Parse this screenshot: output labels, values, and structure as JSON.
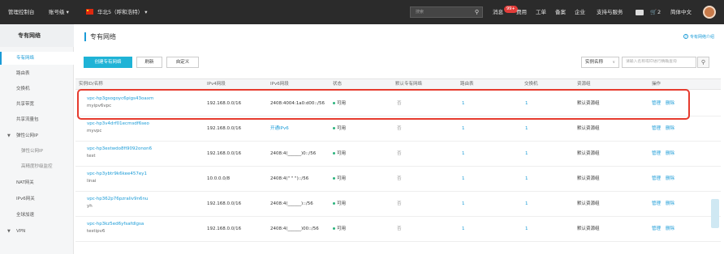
{
  "topbar": {
    "console": "管理控制台",
    "account": "账号级 ▾",
    "region": "华北5（呼和浩特） ▾",
    "search_placeholder": "搜索",
    "search_icon": "search-icon",
    "messages": "消息",
    "badge": "99+",
    "billing": "费用",
    "ticket": "工单",
    "icp": "备案",
    "enterprise": "企业",
    "support": "支持与服务",
    "cart_count": "2",
    "language": "简体中文"
  },
  "sidebar": {
    "title": "专有网络",
    "items": [
      {
        "label": "专有网络",
        "active": true
      },
      {
        "label": "路由表"
      },
      {
        "label": "交换机"
      },
      {
        "label": "共享带宽"
      },
      {
        "label": "共享流量包"
      },
      {
        "label": "弹性公网IP",
        "group": true
      },
      {
        "label": "弹性公网IP",
        "sub": true
      },
      {
        "label": "高精度秒级监控",
        "sub": true
      },
      {
        "label": "NAT网关"
      },
      {
        "label": "IPv6网关"
      },
      {
        "label": "全球加速"
      },
      {
        "label": "VPN",
        "group": true
      }
    ]
  },
  "main": {
    "title": "专有网络",
    "help": "专有网络介绍",
    "buttons": {
      "create": "创建专有网络",
      "refresh": "刷新",
      "custom": "自定义"
    },
    "filter": {
      "select": "实例名称",
      "placeholder": "请输入名称或ID进行精确查询"
    }
  },
  "table": {
    "headers": [
      "实例ID/名称",
      "IPv4网段",
      "IPv6网段",
      "状态",
      "默认专有网络",
      "路由表",
      "交换机",
      "资源组",
      "操作"
    ],
    "rows": [
      {
        "id": "vpc-hp3gsogoyc6pigs43oaxm",
        "name": "myipv6vpc",
        "ipv4": "192.168.0.0/16",
        "ipv6": "2408:4004:1a0:d00::/56",
        "status": "可用",
        "default": "否",
        "route": "1",
        "vsw": "1",
        "rg": "默认资源组",
        "manage": "管理",
        "del": "删除"
      },
      {
        "id": "vpc-hp3v4drf01ecmsdf6seo",
        "name": "myvpc",
        "ipv4": "192.168.0.0/16",
        "ipv6": "开通IPv6",
        "status": "可用",
        "default": "否",
        "route": "1",
        "vsw": "1",
        "rg": "默认资源组",
        "manage": "管理",
        "del": "删除"
      },
      {
        "id": "vpc-hp3estwdo8fi9092onon6",
        "name": "test",
        "ipv4": "192.168.0.0/16",
        "ipv6": "2408:4(______)0::/56",
        "status": "可用",
        "default": "否",
        "route": "1",
        "vsw": "1",
        "rg": "默认资源组",
        "manage": "管理",
        "del": "删除"
      },
      {
        "id": "vpc-hp3ybtr9k6kee457ey1",
        "name": "linai",
        "ipv4": "10.0.0.0/8",
        "ipv6": "2408:4(\"  \"  \")::/56",
        "status": "可用",
        "default": "否",
        "route": "1",
        "vsw": "1",
        "rg": "默认资源组",
        "manage": "管理",
        "del": "删除"
      },
      {
        "id": "vpc-hp362p76pzraliv9n6nu",
        "name": "yh",
        "ipv4": "192.168.0.0/16",
        "ipv6": "2408:4(______)::/56",
        "status": "可用",
        "default": "否",
        "route": "1",
        "vsw": "1",
        "rg": "默认资源组",
        "manage": "管理",
        "del": "删除"
      },
      {
        "id": "vpc-hp3kz5ed6yfsafdlgsa",
        "name": "testipv6",
        "ipv4": "192.168.0.0/16",
        "ipv6": "2408:4(______)00::/56",
        "status": "可用",
        "default": "否",
        "route": "1",
        "vsw": "1",
        "rg": "默认资源组",
        "manage": "管理",
        "del": "删除"
      }
    ]
  },
  "colors": {
    "accent": "#1a9bd7",
    "primary_button": "#1fb3d6",
    "highlight": "#e63b2e",
    "status_ok": "#2ab37c"
  }
}
